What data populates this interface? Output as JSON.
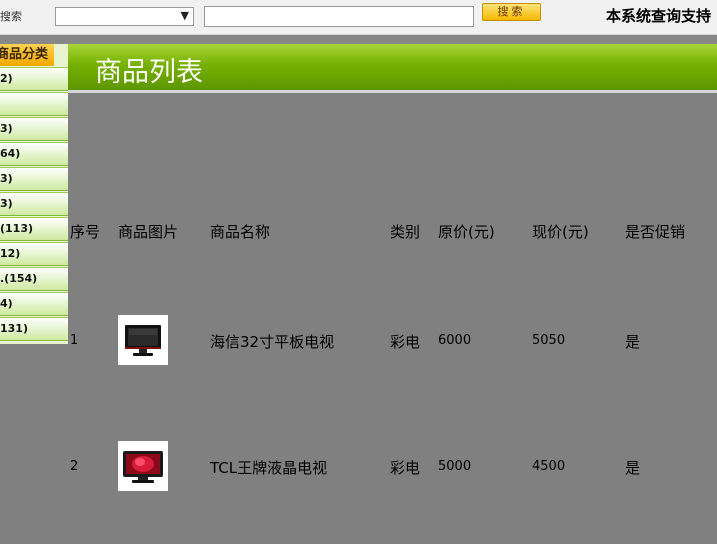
{
  "topbar": {
    "search_label": "搜索",
    "category_select_value": "",
    "keyword_value": "",
    "search_button": "搜索",
    "notice": "本系统查询支持"
  },
  "sidebar": {
    "title": "商品分类",
    "items": [
      {
        "label": "2)"
      },
      {
        "label": ""
      },
      {
        "label": "3)"
      },
      {
        "label": "64)"
      },
      {
        "label": "3)"
      },
      {
        "label": "3)"
      },
      {
        "label": "(113)"
      },
      {
        "label": "12)"
      },
      {
        "label": ".(154)"
      },
      {
        "label": "4)"
      },
      {
        "label": "131)"
      }
    ]
  },
  "page": {
    "title": "商品列表"
  },
  "table": {
    "headers": [
      "序号",
      "商品图片",
      "商品名称",
      "类别",
      "原价(元)",
      "现价(元)",
      "是否促销"
    ],
    "rows": [
      {
        "no": "1",
        "image_icon": "tv-black-icon",
        "name": "海信32寸平板电视",
        "category": "彩电",
        "original_price": "6000",
        "current_price": "5050",
        "promo": "是"
      },
      {
        "no": "2",
        "image_icon": "tv-red-icon",
        "name": "TCL王牌液晶电视",
        "category": "彩电",
        "original_price": "5000",
        "current_price": "4500",
        "promo": "是"
      }
    ]
  },
  "colors": {
    "header_green": "#75b000",
    "button_gold": "#f4b800",
    "background": "#808080"
  }
}
